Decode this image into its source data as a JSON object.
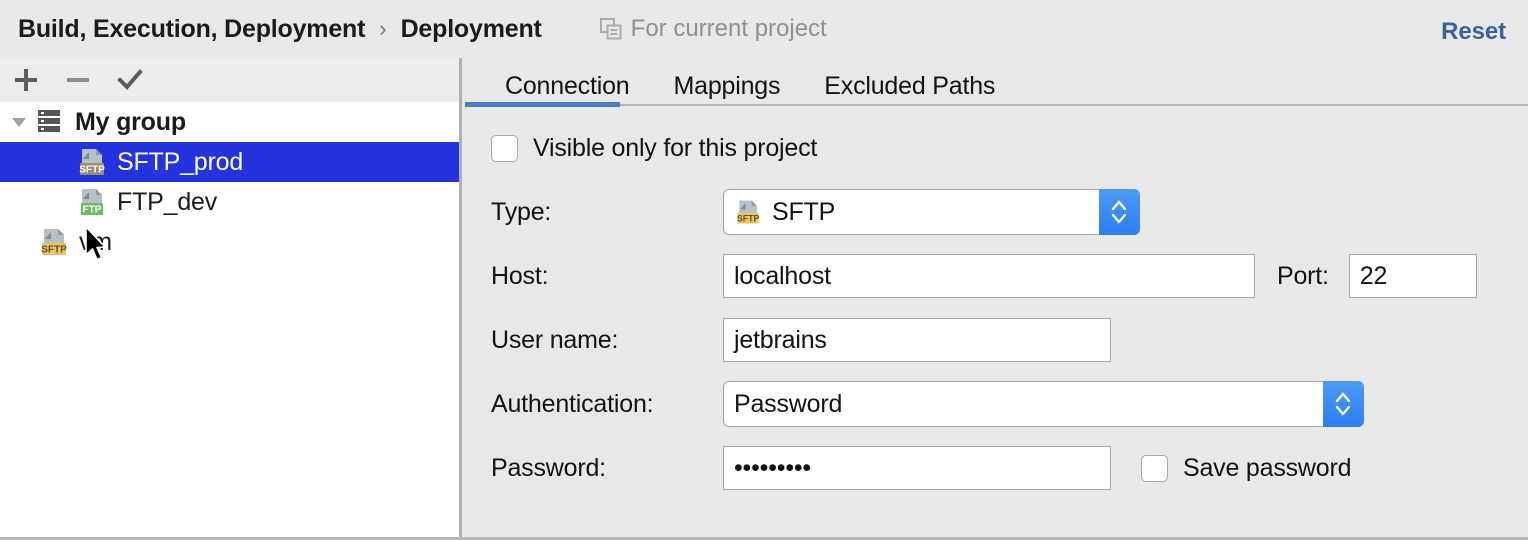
{
  "header": {
    "breadcrumb_root": "Build, Execution, Deployment",
    "breadcrumb_separator": "›",
    "breadcrumb_leaf": "Deployment",
    "scope_icon": "copy-module-icon",
    "scope_label": "For current project",
    "reset_label": "Reset",
    "reset_color": "#35639f"
  },
  "sidebar": {
    "toolbar": {
      "add_icon": "plus-icon",
      "remove_icon": "minus-icon",
      "default_icon": "checkmark-icon"
    },
    "tree": [
      {
        "label": "My group",
        "icon": "group-icon",
        "level": 0,
        "expanded": true,
        "selected": false,
        "bold": true
      },
      {
        "label": "SFTP_prod",
        "icon": "sftp-icon",
        "level": 1,
        "selected": true,
        "bold": false
      },
      {
        "label": "FTP_dev",
        "icon": "ftp-icon",
        "level": 1,
        "selected": false,
        "bold": false
      },
      {
        "label": "vm",
        "icon": "sftp-icon",
        "level": 0,
        "selected": false,
        "bold": false
      }
    ],
    "selection_color": "#2333dd"
  },
  "content": {
    "tabs": [
      {
        "label": "Connection",
        "active": true
      },
      {
        "label": "Mappings",
        "active": false
      },
      {
        "label": "Excluded Paths",
        "active": false
      }
    ],
    "active_tab_underline_color": "#4a7ebb",
    "visible_only": {
      "label": "Visible only for this project",
      "checked": false
    },
    "type": {
      "label": "Type:",
      "icon": "sftp-icon",
      "value": "SFTP"
    },
    "host": {
      "label": "Host:",
      "value": "localhost"
    },
    "port": {
      "label": "Port:",
      "value": "22"
    },
    "username": {
      "label": "User name:",
      "value": "jetbrains"
    },
    "authentication": {
      "label": "Authentication:",
      "value": "Password"
    },
    "password": {
      "label": "Password:",
      "value": "•••••••••"
    },
    "save_password": {
      "label": "Save password",
      "checked": false
    }
  }
}
